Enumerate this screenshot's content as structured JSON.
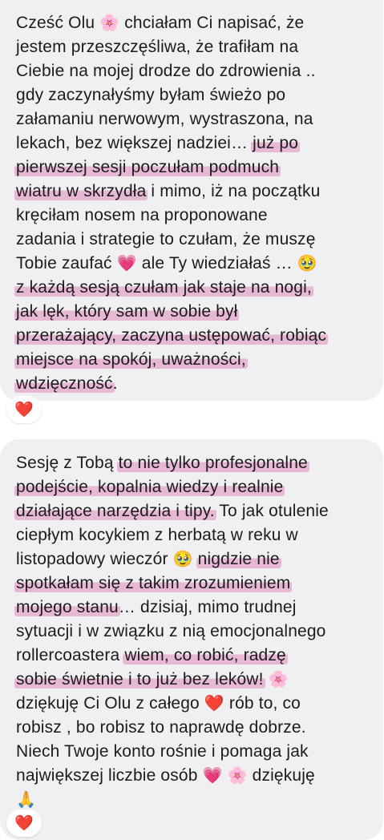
{
  "message1": {
    "lines": [
      [
        {
          "t": "Cześć Olu "
        },
        {
          "t": "🌸",
          "emoji": "flower"
        },
        {
          "t": " chciałam Ci napisać, że"
        }
      ],
      [
        {
          "t": "jestem przeszczęśliwa, że trafiłam na"
        }
      ],
      [
        {
          "t": "Ciebie na mojej drodze do zdrowienia .."
        }
      ],
      [
        {
          "t": "gdy zaczynałyśmy byłam świeżo po"
        }
      ],
      [
        {
          "t": "załamaniu nerwowym, wystraszona, na"
        }
      ],
      [
        {
          "t": "lekach, bez większej nadziei… "
        },
        {
          "t": "już po",
          "hl": true
        }
      ],
      [
        {
          "t": "pierwszej sesji poczułam podmuch",
          "hl": true
        }
      ],
      [
        {
          "t": "wiatru w skrzydła",
          "hl": true
        },
        {
          "t": " i mimo, iż na początku"
        }
      ],
      [
        {
          "t": "kręciłam nosem na proponowane"
        }
      ],
      [
        {
          "t": "zadania i strategie to czułam, że muszę"
        }
      ],
      [
        {
          "t": "Tobie zaufać "
        },
        {
          "t": "💗",
          "emoji": "heart"
        },
        {
          "t": " ale Ty wiedziałaś … "
        },
        {
          "t": "🥹",
          "emoji": "face"
        }
      ],
      [
        {
          "t": "z każdą sesją czułam jak staje na nogi,",
          "hl": true
        }
      ],
      [
        {
          "t": "jak lęk, który sam w sobie był",
          "hl": true
        }
      ],
      [
        {
          "t": "przerażający, zaczyna ustępować, robiąc",
          "hl": true
        }
      ],
      [
        {
          "t": "miejsce na spokój, uważności,",
          "hl": true
        }
      ],
      [
        {
          "t": "wdzięczność",
          "hl": true
        },
        {
          "t": "."
        }
      ]
    ],
    "reaction": "❤️"
  },
  "message2": {
    "lines": [
      [
        {
          "t": "Sesję z Tobą "
        },
        {
          "t": "to nie tylko profesjonalne",
          "hl": true
        }
      ],
      [
        {
          "t": "podejście, kopalnia wiedzy i realnie",
          "hl": true
        }
      ],
      [
        {
          "t": "działające narzędzia i tipy.",
          "hl": true
        },
        {
          "t": " To jak otulenie"
        }
      ],
      [
        {
          "t": "ciepłym kocykiem z herbatą w reku w"
        }
      ],
      [
        {
          "t": "listopadowy wieczór "
        },
        {
          "t": "🥹",
          "emoji": "face"
        },
        {
          "t": " "
        },
        {
          "t": "nigdzie nie",
          "hl": true
        }
      ],
      [
        {
          "t": "spotkałam się z takim zrozumieniem",
          "hl": true
        }
      ],
      [
        {
          "t": "mojego stanu",
          "hl": true
        },
        {
          "t": "… dzisiaj, mimo trudnej"
        }
      ],
      [
        {
          "t": "sytuacji i w związku z nią emocjonalnego"
        }
      ],
      [
        {
          "t": "rollercoastera "
        },
        {
          "t": "wiem, co robić, radzę",
          "hl": true
        }
      ],
      [
        {
          "t": "sobie świetnie i to już  bez leków!",
          "hl": true
        },
        {
          "t": " "
        },
        {
          "t": "🌸",
          "emoji": "flower"
        }
      ],
      [
        {
          "t": "dziękuję Ci Olu z całego "
        },
        {
          "t": "❤️",
          "emoji": "heart"
        },
        {
          "t": " rób to, co"
        }
      ],
      [
        {
          "t": "robisz , bo robisz to naprawdę dobrze."
        }
      ],
      [
        {
          "t": "Niech Twoje konto rośnie i pomaga jak"
        }
      ],
      [
        {
          "t": "największej liczbie osób "
        },
        {
          "t": "💗",
          "emoji": "heart"
        },
        {
          "t": " "
        },
        {
          "t": "🌸",
          "emoji": "flower"
        },
        {
          "t": " dziękuję"
        }
      ],
      [
        {
          "t": "🙏",
          "emoji": "hands"
        }
      ]
    ],
    "reaction": "❤️"
  }
}
